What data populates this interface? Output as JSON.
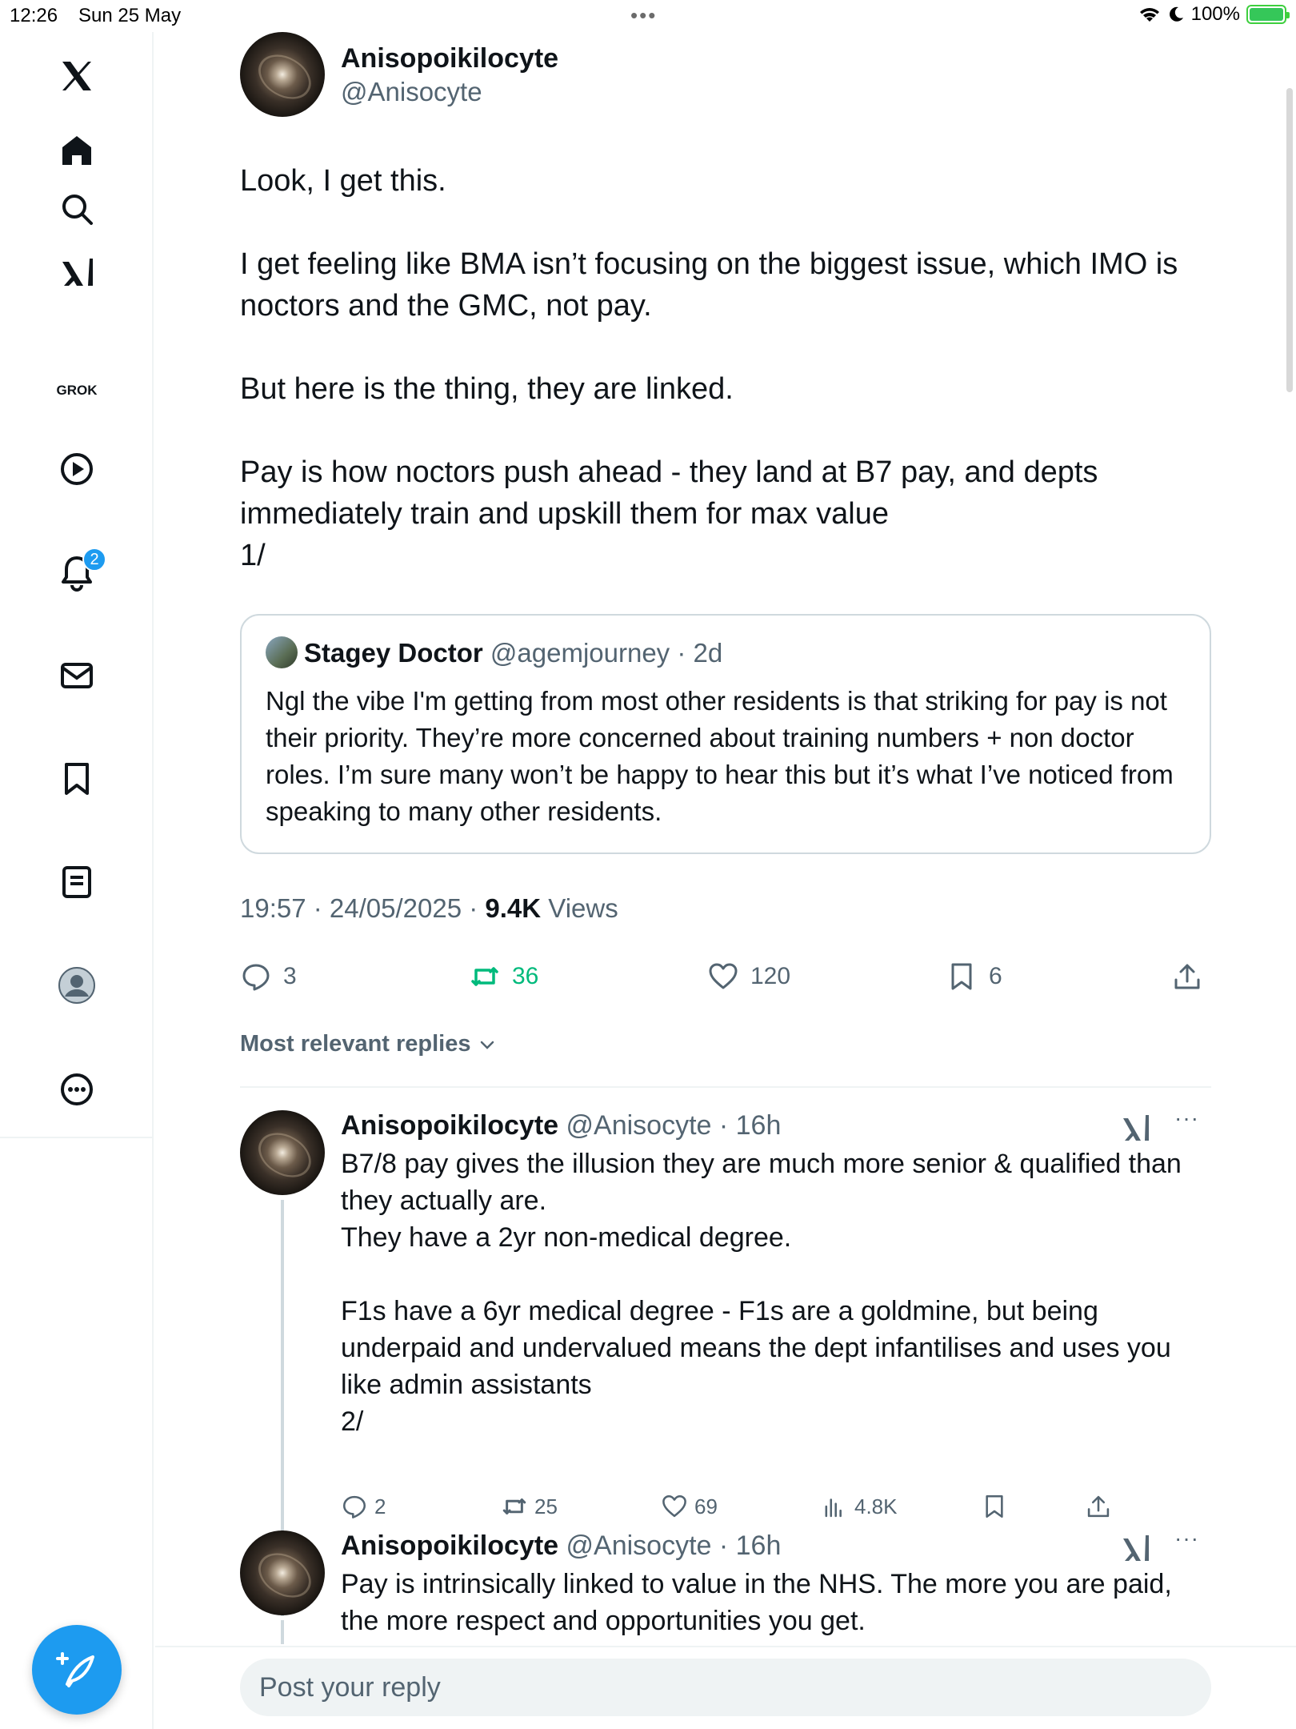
{
  "status": {
    "time": "12:26",
    "date": "Sun 25 May",
    "battery": "100%"
  },
  "sidebar": {
    "grok_label": "GROK",
    "notifications_badge": "2"
  },
  "tweet": {
    "author_name": "Anisopoikilocyte",
    "author_handle": "@Anisocyte",
    "text": "Look, I get this.\n\nI get feeling like BMA isn’t focusing on the biggest issue, which IMO is noctors and the GMC, not pay.\n\nBut here is the thing, they are linked.\n\nPay is how noctors push ahead - they land at B7 pay, and depts immediately train and upskill them for max value\n1/",
    "quote": {
      "name": "Stagey Doctor",
      "meta": "@agemjourney · 2d",
      "text": "Ngl the vibe I'm getting from most other residents is that striking for pay is not their priority. They’re more concerned about training numbers + non doctor roles. I’m sure many won’t be happy to hear this but it’s what I’ve noticed from speaking to many other residents."
    },
    "timestamp": "19:57 · 24/05/2025 · ",
    "views_count": "9.4K",
    "views_label": " Views",
    "replies": "3",
    "reposts": "36",
    "likes": "120",
    "bookmarks": "6"
  },
  "sort_label": "Most relevant replies",
  "replies": [
    {
      "name": "Anisopoikilocyte",
      "meta": "@Anisocyte · 16h",
      "text": "B7/8 pay gives the illusion they are much more senior & qualified than they actually are.\nThey have a 2yr non-medical degree.\n\nF1s have a 6yr medical degree - F1s are a goldmine, but being underpaid and undervalued means the dept infantilises and uses you like admin assistants\n2/",
      "replies": "2",
      "reposts": "25",
      "likes": "69",
      "views": "4.8K"
    },
    {
      "name": "Anisopoikilocyte",
      "meta": "@Anisocyte · 16h",
      "text": "Pay is intrinsically linked to value in the NHS. The more you are paid, the more respect and opportunities you get."
    }
  ],
  "reply_box": {
    "placeholder": "Post your reply"
  },
  "colors": {
    "accent": "#1d9bf0",
    "repost_active": "#00ba7c",
    "muted": "#536471"
  }
}
